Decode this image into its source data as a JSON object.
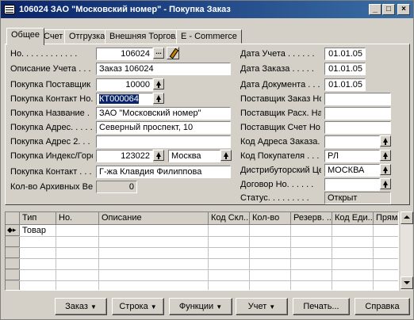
{
  "window": {
    "title": "106024 ЗАО \"Московский номер\" - Покупка Заказ",
    "minimize": "_",
    "maximize": "□",
    "close": "×"
  },
  "tabs": [
    "Общее",
    "Счет",
    "Отгрузка",
    "Внешняя Торговля",
    "E - Commerce"
  ],
  "left": {
    "no_label": "Но. . . . . . . . . . . .",
    "no_value": "106024",
    "desc_label": "Описание Учета . . . .",
    "desc_value": "Заказ 106024",
    "vendor_label": "Покупка Поставщик ...",
    "vendor_value": "10000",
    "contact_no_label": "Покупка Контакт Но. .",
    "contact_no_value": "КТ000064",
    "name_label": "Покупка Название . . .",
    "name_value": "ЗАО \"Московский номер\"",
    "address_label": "Покупка Адрес. . . . .",
    "address_value": "Северный проспект, 10",
    "address2_label": "Покупка Адрес 2. . . .",
    "address2_value": "",
    "postcode_label": "Покупка Индекс/Город.",
    "postcode_value": "123022",
    "city_value": "Москва",
    "contact_label": "Покупка Контакт  . . .",
    "contact_value": "Г-жа Клавдия Филиппова",
    "archive_label": "Кол-во Архивных Ве...",
    "archive_value": "0"
  },
  "right": {
    "posting_date_label": "Дата Учета . . . . . .",
    "posting_date_value": "01.01.05",
    "order_date_label": "Дата Заказа . . . . .",
    "order_date_value": "01.01.05",
    "doc_date_label": "Дата Документа . . . .",
    "doc_date_value": "01.01.05",
    "vendor_order_label": "Поставщик Заказ Но. .",
    "vendor_order_value": "",
    "vendor_shipment_label": "Поставщик Расх. Нак...",
    "vendor_shipment_value": "",
    "vendor_invoice_label": "Поставщик Счет Но. . .",
    "vendor_invoice_value": "",
    "order_address_label": "Код Адреса Заказа. . .",
    "order_address_value": "",
    "purchaser_label": "Код Покупателя . . . .",
    "purchaser_value": "РЛ",
    "resp_center_label": "Дистрибуторский Це...",
    "resp_center_value": "МОСКВА",
    "contract_label": "Договор Но. . . . . .",
    "contract_value": "",
    "status_label": "Статус. . . . . . . . .",
    "status_value": "Открыт"
  },
  "grid": {
    "columns": [
      "Тип",
      "Но.",
      "Описание",
      "Код Скл...",
      "Кол-во",
      "Резерв. ...",
      "Код Еди...",
      "Прямая"
    ],
    "rows": [
      {
        "type": "Товар",
        "no": "",
        "desc": "",
        "loc": "",
        "qty": "",
        "reserved": "",
        "uom": "",
        "direct": ""
      }
    ]
  },
  "buttons": {
    "order": "Заказ",
    "line": "Строка",
    "functions": "Функции",
    "posting": "Учет",
    "print": "Печать...",
    "help": "Справка"
  }
}
